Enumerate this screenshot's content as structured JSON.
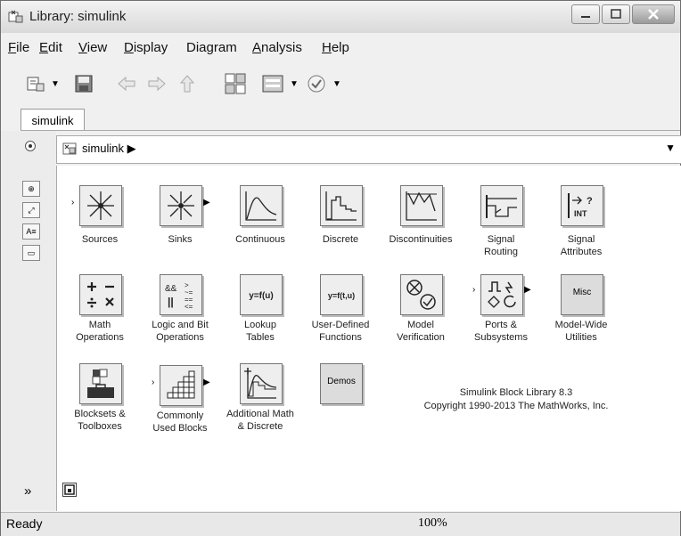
{
  "window": {
    "title": "Library: simulink"
  },
  "menu": [
    {
      "pre": "",
      "ul": "F",
      "post": "ile"
    },
    {
      "pre": "",
      "ul": "E",
      "post": "dit"
    },
    {
      "pre": "",
      "ul": "V",
      "post": "iew"
    },
    {
      "pre": "",
      "ul": "D",
      "post": "isplay"
    },
    {
      "pre": "Dia",
      "ul": "g",
      "post": "ram"
    },
    {
      "pre": "",
      "ul": "A",
      "post": "nalysis"
    },
    {
      "pre": "",
      "ul": "H",
      "post": "elp"
    }
  ],
  "tab": {
    "label": "simulink"
  },
  "address": {
    "path": "simulink",
    "separator": "▶"
  },
  "blocks": [
    {
      "label1": "Sources",
      "label2": "",
      "icon": "sources-icon"
    },
    {
      "label1": "Sinks",
      "label2": "",
      "icon": "sinks-icon"
    },
    {
      "label1": "Continuous",
      "label2": "",
      "icon": "continuous-icon"
    },
    {
      "label1": "Discrete",
      "label2": "",
      "icon": "discrete-icon"
    },
    {
      "label1": "Discontinuities",
      "label2": "",
      "icon": "discontinuities-icon"
    },
    {
      "label1": "Signal",
      "label2": "Routing",
      "icon": "signal-routing-icon"
    },
    {
      "label1": "Signal",
      "label2": "Attributes",
      "icon": "signal-attributes-icon"
    },
    {
      "label1": "Math",
      "label2": "Operations",
      "icon": "math-operations-icon"
    },
    {
      "label1": "Logic and Bit",
      "label2": "Operations",
      "icon": "logic-bit-icon"
    },
    {
      "label1": "Lookup",
      "label2": "Tables",
      "icon": "lookup-tables-icon"
    },
    {
      "label1": "User-Defined",
      "label2": "Functions",
      "icon": "user-defined-icon"
    },
    {
      "label1": "Model",
      "label2": "Verification",
      "icon": "model-verification-icon"
    },
    {
      "label1": "Ports &",
      "label2": "Subsystems",
      "icon": "ports-subsystems-icon"
    },
    {
      "label1": "Model-Wide",
      "label2": "Utilities",
      "icon": "model-wide-icon"
    },
    {
      "label1": "Blocksets &",
      "label2": "Toolboxes",
      "icon": "blocksets-icon"
    },
    {
      "label1": "Commonly",
      "label2": "Used Blocks",
      "icon": "commonly-used-icon"
    },
    {
      "label1": "Additional Math",
      "label2": "& Discrete",
      "icon": "additional-math-icon"
    },
    {
      "label1": "",
      "label2": "",
      "icon": "demos-icon"
    }
  ],
  "icon_text": {
    "lookup": "y=f(u)",
    "userdef": "y=f(t,u)",
    "misc": "Misc",
    "demos": "Demos",
    "signal_attr_top": "?",
    "signal_attr_bottom": "INT"
  },
  "library_info": {
    "line1": "Simulink Block Library 8.3",
    "line2": "Copyright 1990-2013 The MathWorks, Inc."
  },
  "status": {
    "left": "Ready",
    "zoom": "100%"
  }
}
